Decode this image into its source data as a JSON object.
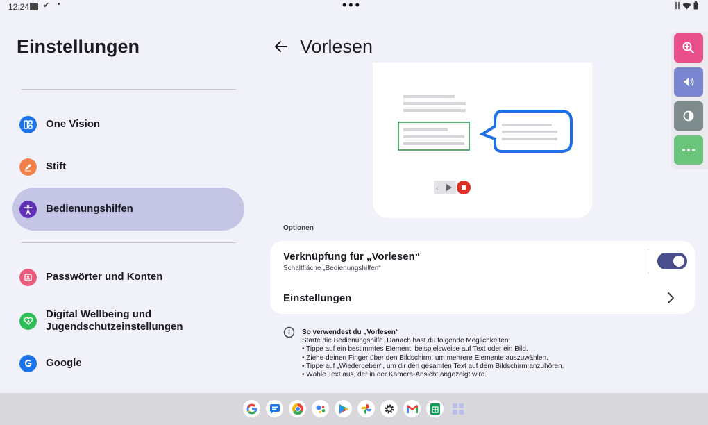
{
  "status_bar": {
    "time": "12:24"
  },
  "left_pane": {
    "title": "Einstellungen",
    "items": [
      {
        "label": "One Vision",
        "icon": "one-vision-icon",
        "color": "#1a73e8"
      },
      {
        "label": "Stift",
        "icon": "pen-icon",
        "color": "#f2804a"
      },
      {
        "label": "Bedienungshilfen",
        "icon": "accessibility-icon",
        "color": "#5f2fb8",
        "selected": true
      },
      {
        "label": "Passwörter und Konten",
        "icon": "account-icon",
        "color": "#ec5a7c"
      },
      {
        "label_line1": "Digital Wellbeing und",
        "label_line2": "Jugendschutzeinstellungen",
        "icon": "wellbeing-icon",
        "color": "#2fbf59"
      },
      {
        "label": "Google",
        "icon": "google-icon",
        "color": "#1a73e8"
      }
    ]
  },
  "detail": {
    "title": "Vorlesen",
    "options_label": "Optionen",
    "shortcut": {
      "title": "Verknüpfung für „Vorlesen“",
      "subtitle": "Schaltfläche „Bedienungshilfen“",
      "enabled": true
    },
    "settings_label": "Einstellungen",
    "info": {
      "title": "So verwendest du „Vorlesen“",
      "lines": [
        "Starte die Bedienungshilfe. Danach hast du folgende Möglichkeiten:",
        "• Tippe auf ein bestimmtes Element, beispielsweise auf Text oder ein Bild.",
        "• Ziehe deinen Finger über den Bildschirm, um mehrere Elemente auszuwählen.",
        "• Tippe auf „Wiedergeben“, um dir den gesamten Text auf dem Bildschirm anzuhören.",
        "• Wähle Text aus, der in der Kamera-Ansicht angezeigt wird."
      ]
    }
  },
  "floating_menu": [
    {
      "icon": "zoom-icon",
      "color": "#e94f8a"
    },
    {
      "icon": "volume-icon",
      "color": "#7a86cf"
    },
    {
      "icon": "contrast-icon",
      "color": "#7d8b8c"
    },
    {
      "icon": "more-icon",
      "color": "#6cc57c"
    }
  ],
  "dock": [
    "google-app-icon",
    "messages-icon",
    "chrome-icon",
    "assistant-icon",
    "play-store-icon",
    "photos-icon",
    "settings-gear-icon",
    "gmail-icon",
    "sheets-icon",
    "app-drawer-icon"
  ]
}
